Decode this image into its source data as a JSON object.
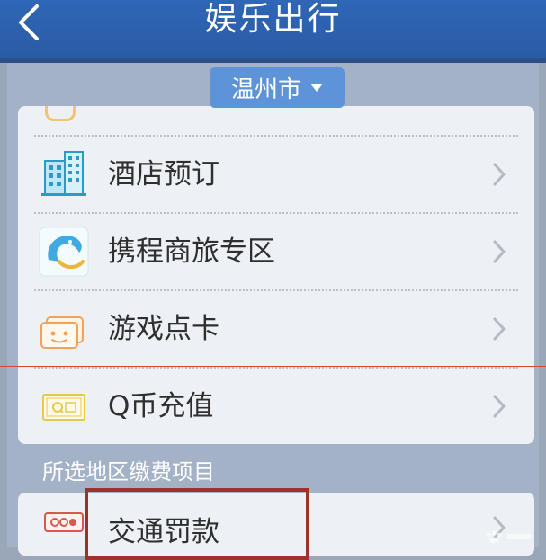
{
  "header": {
    "title": "娱乐出行"
  },
  "city_selector": {
    "value": "温州市"
  },
  "menu": {
    "items": [
      {
        "label": "酒店预订",
        "icon": "hotel-icon"
      },
      {
        "label": "携程商旅专区",
        "icon": "ctrip-dolphin-icon"
      },
      {
        "label": "游戏点卡",
        "icon": "game-card-icon"
      },
      {
        "label": "Q币充值",
        "icon": "q-coin-icon"
      }
    ]
  },
  "section": {
    "label": "所选地区缴费项目"
  },
  "payments": {
    "items": [
      {
        "label": "交通罚款",
        "icon": "traffic-fine-icon"
      }
    ]
  },
  "colors": {
    "header": "#2f66b6",
    "city_button": "#5d93d8",
    "card": "#edf0f4",
    "highlight_border": "#a0302c"
  }
}
